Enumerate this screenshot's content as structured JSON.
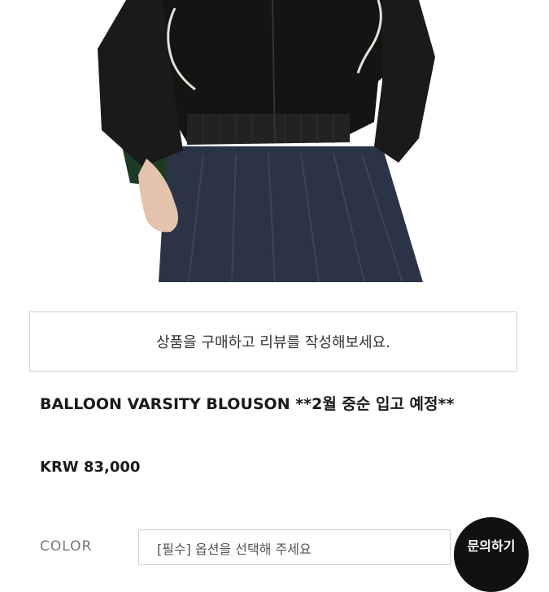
{
  "product": {
    "review_prompt": "상품을 구매하고 리뷰를 작성해보세요.",
    "name": "BALLOON VARSITY BLOUSON **2월 중순 입고 예정**",
    "price": "KRW 83,000"
  },
  "options": {
    "color_label": "COLOR",
    "color_placeholder": "[필수] 옵션을 선택해 주세요"
  },
  "floating": {
    "inquiry_label": "문의하기"
  },
  "photo": {
    "subject": "model wearing black varsity blouson and navy denim pleated skirt"
  },
  "colors": {
    "jacket": "#111111",
    "skirt": "#2b3346",
    "border": "#d2d2d2",
    "button": "#111111"
  }
}
